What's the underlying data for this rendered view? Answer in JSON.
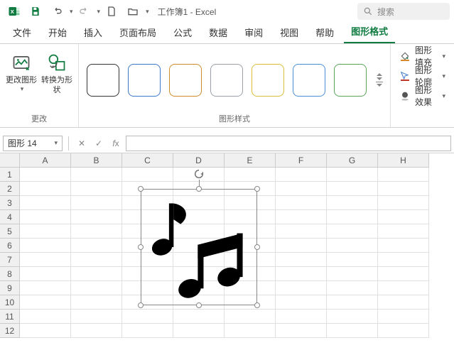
{
  "titlebar": {
    "doc_title": "工作簿1 - Excel",
    "search_placeholder": "搜索"
  },
  "tabs": {
    "items": [
      "文件",
      "开始",
      "插入",
      "页面布局",
      "公式",
      "数据",
      "审阅",
      "视图",
      "帮助",
      "图形格式"
    ],
    "active_index": 9
  },
  "ribbon": {
    "change_group_label": "更改",
    "change_graphic_label": "更改图形",
    "convert_shape_label": "转换为形状",
    "styles_group_label": "图形样式",
    "style_swatch_colors": [
      "#333333",
      "#3a78c8",
      "#d08a2a",
      "#9aa0a6",
      "#d9bc3a",
      "#4a8fd6",
      "#5aa457"
    ],
    "fill_label": "图形填充",
    "outline_label": "图形轮廓",
    "effects_label": "图形效果"
  },
  "formula_bar": {
    "name_box_value": "图形 14",
    "formula_value": ""
  },
  "grid": {
    "columns": [
      "A",
      "B",
      "C",
      "D",
      "E",
      "F",
      "G",
      "H"
    ],
    "rows": [
      "1",
      "2",
      "3",
      "4",
      "5",
      "6",
      "7",
      "8",
      "9",
      "10",
      "11",
      "12"
    ]
  },
  "shape": {
    "icon_name": "music-notes-icon"
  },
  "colors": {
    "accent": "#107c41"
  }
}
